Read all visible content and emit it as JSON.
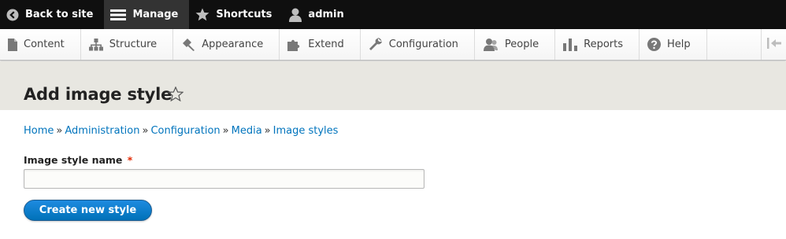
{
  "toolbar": {
    "back_label": "Back to site",
    "manage_label": "Manage",
    "shortcuts_label": "Shortcuts",
    "user_label": "admin"
  },
  "tray": {
    "items": [
      {
        "label": "Content",
        "icon": "file-icon"
      },
      {
        "label": "Structure",
        "icon": "sitemap-icon"
      },
      {
        "label": "Appearance",
        "icon": "paint-icon"
      },
      {
        "label": "Extend",
        "icon": "puzzle-icon"
      },
      {
        "label": "Configuration",
        "icon": "wrench-icon"
      },
      {
        "label": "People",
        "icon": "people-icon"
      },
      {
        "label": "Reports",
        "icon": "bar-chart-icon"
      },
      {
        "label": "Help",
        "icon": "help-icon"
      }
    ],
    "toggle_icon": "collapse-tray-icon"
  },
  "page": {
    "title": "Add image style"
  },
  "breadcrumb": {
    "items": [
      "Home",
      "Administration",
      "Configuration",
      "Media",
      "Image styles"
    ],
    "separator": "»"
  },
  "form": {
    "name_label": "Image style name",
    "required_marker": "*",
    "name_value": "",
    "submit_label": "Create new style"
  },
  "colors": {
    "toolbar_bg": "#0f0f0f",
    "active_tab_bg": "#333333",
    "header_bg": "#e8e7e1",
    "link": "#0074bd",
    "button": "#0071b8",
    "required": "#e32700"
  }
}
